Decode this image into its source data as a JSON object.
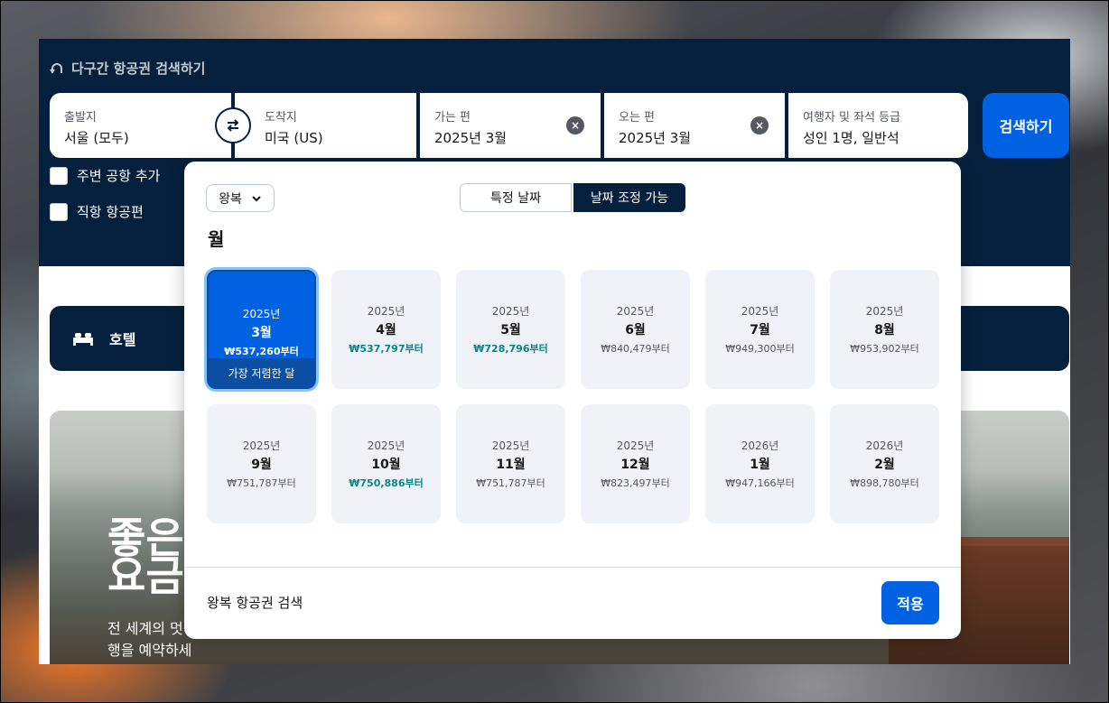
{
  "header": {
    "multicity_link": "다구간 항공권 검색하기"
  },
  "search": {
    "origin": {
      "label": "출발지",
      "value": "서울 (모두)"
    },
    "destination": {
      "label": "도착지",
      "value": "미국 (US)"
    },
    "depart": {
      "label": "가는 편",
      "value": "2025년 3월"
    },
    "return": {
      "label": "오는 편",
      "value": "2025년 3월"
    },
    "travellers": {
      "label": "여행자 및 좌석 등급",
      "value": "성인 1명, 일반석"
    },
    "search_button": "검색하기",
    "clear_symbol": "×"
  },
  "options": {
    "nearby_airports": "주변 공항 추가",
    "direct_flights": "직항 항공편"
  },
  "hotel_tab": {
    "label": "호텔"
  },
  "promo": {
    "title": "좋은 요금",
    "subtitle": "전 세계의 멋 행을 예약하세요."
  },
  "calendar": {
    "trip_type": "왕복",
    "tab_specific": "특정 날짜",
    "tab_flexible": "날짜 조정 가능",
    "heading": "월",
    "cheapest_badge": "가장 저렴한 달",
    "months": [
      {
        "year": "2025년",
        "month": "3월",
        "price": "₩537,260부터",
        "selected": true,
        "green": false
      },
      {
        "year": "2025년",
        "month": "4월",
        "price": "₩537,797부터",
        "selected": false,
        "green": true
      },
      {
        "year": "2025년",
        "month": "5월",
        "price": "₩728,796부터",
        "selected": false,
        "green": true
      },
      {
        "year": "2025년",
        "month": "6월",
        "price": "₩840,479부터",
        "selected": false,
        "green": false
      },
      {
        "year": "2025년",
        "month": "7월",
        "price": "₩949,300부터",
        "selected": false,
        "green": false
      },
      {
        "year": "2025년",
        "month": "8월",
        "price": "₩953,902부터",
        "selected": false,
        "green": false
      },
      {
        "year": "2025년",
        "month": "9월",
        "price": "₩751,787부터",
        "selected": false,
        "green": false
      },
      {
        "year": "2025년",
        "month": "10월",
        "price": "₩750,886부터",
        "selected": false,
        "green": true
      },
      {
        "year": "2025년",
        "month": "11월",
        "price": "₩751,787부터",
        "selected": false,
        "green": false
      },
      {
        "year": "2025년",
        "month": "12월",
        "price": "₩823,497부터",
        "selected": false,
        "green": false
      },
      {
        "year": "2026년",
        "month": "1월",
        "price": "₩947,166부터",
        "selected": false,
        "green": false
      },
      {
        "year": "2026년",
        "month": "2월",
        "price": "₩898,780부터",
        "selected": false,
        "green": false
      }
    ],
    "footer_text": "왕복 항공권 검색",
    "apply_button": "적용"
  },
  "colors": {
    "navy": "#05203c",
    "primary_blue": "#0062e3",
    "price_green": "#0c838a",
    "card_bg": "#eff3f8"
  }
}
